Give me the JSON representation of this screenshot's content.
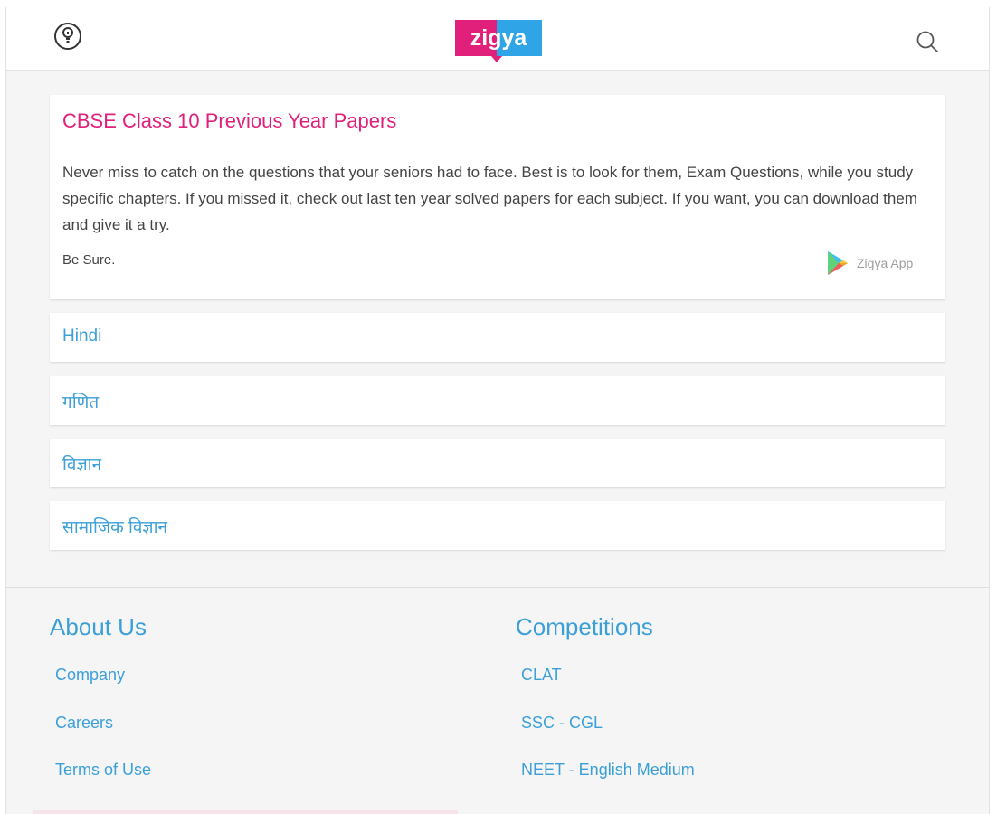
{
  "header": {
    "menu_icon": "question-lightbulb-icon",
    "logo_text": "zigya",
    "search_icon": "search-icon",
    "brand_pink": "#e0207a",
    "brand_blue": "#2fa4e7"
  },
  "intro": {
    "title": "CBSE Class 10 Previous Year Papers",
    "description": "Never miss to catch on the questions that your seniors had to face. Best is to look for them, Exam Questions, while you study specific chapters. If you missed it, check out last ten year solved papers for each subject. If you want, you can download them and give it a try.",
    "note": "Be Sure.",
    "app_icon": "google-play-icon",
    "app_label": "Zigya App"
  },
  "subjects": [
    {
      "label": "Hindi"
    },
    {
      "label": "गणित"
    },
    {
      "label": "विज्ञान"
    },
    {
      "label": "सामाजिक विज्ञान"
    }
  ],
  "footer": {
    "about": {
      "title": "About Us",
      "links": [
        "Company",
        "Careers",
        "Terms of Use"
      ]
    },
    "competitions": {
      "title": "Competitions",
      "links": [
        "CLAT",
        "SSC - CGL",
        "NEET - English Medium"
      ]
    }
  },
  "colors": {
    "link": "#3ba0d8",
    "title": "#e0207a",
    "background": "#f5f5f5"
  }
}
